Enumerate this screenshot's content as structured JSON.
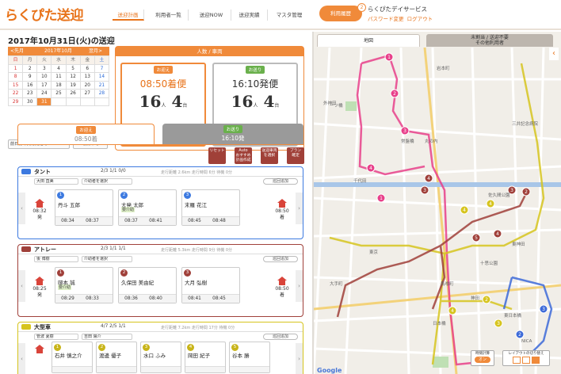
{
  "header": {
    "logo": "らくぴた送迎",
    "nav": [
      "送迎計画",
      "利用者一覧",
      "送迎NOW",
      "送迎実績",
      "マスタ管理"
    ],
    "plan_button": "利用履歴",
    "plan_badge": "2",
    "service_name": "らくぴたデイサービス",
    "password_link": "パスワード変更",
    "logout_link": "ログアウト"
  },
  "page": {
    "title": "2017年10月31日(火)の送迎"
  },
  "calendar": {
    "prev": "<先月",
    "month": "2017年10月",
    "next": "翌月>",
    "weekdays": [
      "日",
      "月",
      "火",
      "水",
      "木",
      "金",
      "土"
    ],
    "days": [
      "1",
      "2",
      "3",
      "4",
      "5",
      "6",
      "7",
      "8",
      "9",
      "10",
      "11",
      "12",
      "13",
      "14",
      "15",
      "16",
      "17",
      "18",
      "19",
      "20",
      "21",
      "22",
      "23",
      "24",
      "25",
      "26",
      "27",
      "28",
      "29",
      "30",
      "31",
      "",
      "",
      "",
      ""
    ],
    "selected": "31",
    "btn_copy": "前日",
    "btn_copy_label": "前日分の実行開始で",
    "btn_delete": "削除する"
  },
  "summary": {
    "header": "人数 / 車両",
    "pickup_tag": "お迎え",
    "pickup_title": "08:50着便",
    "pickup_people": "16",
    "pickup_cars": "4",
    "dropoff_tag": "お送り",
    "dropoff_title": "16:10発便",
    "dropoff_people": "16",
    "dropoff_cars": "4",
    "unit_people": "人",
    "unit_cars": "台"
  },
  "tabs": {
    "pickup_tag": "お迎え",
    "pickup_time": "08:50着",
    "dropoff_tag": "お送り",
    "dropoff_time": "16:10発"
  },
  "tools": [
    "リセット",
    "Auto\nおすすめ\n計画作成",
    "送迎車両\nを選択",
    "プラン\n確定"
  ],
  "vehicles": [
    {
      "name": "タント",
      "capacity": "2/3  1/1  0/0",
      "distance": "走行距離 2.6km 走行時間 6分 待機 0分",
      "driver": "大田 直美",
      "helper": "介助者を選択",
      "add": "巡回追加",
      "start_time": "08:32",
      "start_label": "発",
      "end_time": "08:50",
      "end_label": "着",
      "stops": [
        {
          "num": "1",
          "name": "丹斗 五郎",
          "arr": "08:34",
          "dep": "08:37"
        },
        {
          "num": "2",
          "name": "大発 太郎",
          "badge": "要介助",
          "arr": "08:37",
          "dep": "08:41"
        },
        {
          "num": "3",
          "name": "末羅 花江",
          "arr": "08:45",
          "dep": "08:48"
        }
      ]
    },
    {
      "name": "アトレー",
      "capacity": "2/3  1/1  1/1",
      "distance": "走行距離 5.3km 走行時間 9分 待機 0分",
      "driver": "後 博樹",
      "helper": "介助者を選択",
      "add": "巡回追加",
      "start_time": "08:25",
      "start_label": "発",
      "end_time": "08:50",
      "end_label": "着",
      "stops": [
        {
          "num": "1",
          "name": "岡本 誠",
          "badge": "要介助",
          "arr": "08:29",
          "dep": "08:33"
        },
        {
          "num": "2",
          "name": "久保田 美由紀",
          "arr": "08:36",
          "dep": "08:40"
        },
        {
          "num": "3",
          "name": "大月 弘樹",
          "arr": "08:41",
          "dep": "08:45"
        }
      ]
    },
    {
      "name": "大型車",
      "capacity": "4/7  2/5  1/1",
      "distance": "走行距離 7.2km 走行時間 17分 待機 0分",
      "driver": "管波 夏樹",
      "helper": "吉田 陽介",
      "add": "巡回追加",
      "stops": [
        {
          "num": "1",
          "name": "石井 慎之介"
        },
        {
          "num": "2",
          "name": "渡邊 優子"
        },
        {
          "num": "3",
          "name": "水口 ふみ"
        },
        {
          "num": "4",
          "name": "岡田 紀子"
        },
        {
          "num": "5",
          "name": "谷本 勝"
        }
      ]
    }
  ],
  "map": {
    "tab_map": "地図",
    "tab_unassigned_1": "未割当 / 送迎不要",
    "tab_unassigned_2": "その他利用者",
    "toggle_label": "時間計算",
    "toggle_state": "オン",
    "layout_label": "レイアウトの切り替え",
    "google": "Google",
    "labels": [
      "神田",
      "岩本町",
      "東神田",
      "東日本橋",
      "馬喰町",
      "大手町",
      "東京",
      "日本橋",
      "NICA",
      "一ツ橋",
      "丸の内",
      "常盤橋",
      "千代田",
      "三井記念病院",
      "佐久間公園",
      "外神田",
      "十思公園"
    ],
    "colors": {
      "pink": "#e8408a",
      "gold": "#d6c41e",
      "brown": "#a0403a",
      "blue": "#3d6ad8"
    }
  }
}
